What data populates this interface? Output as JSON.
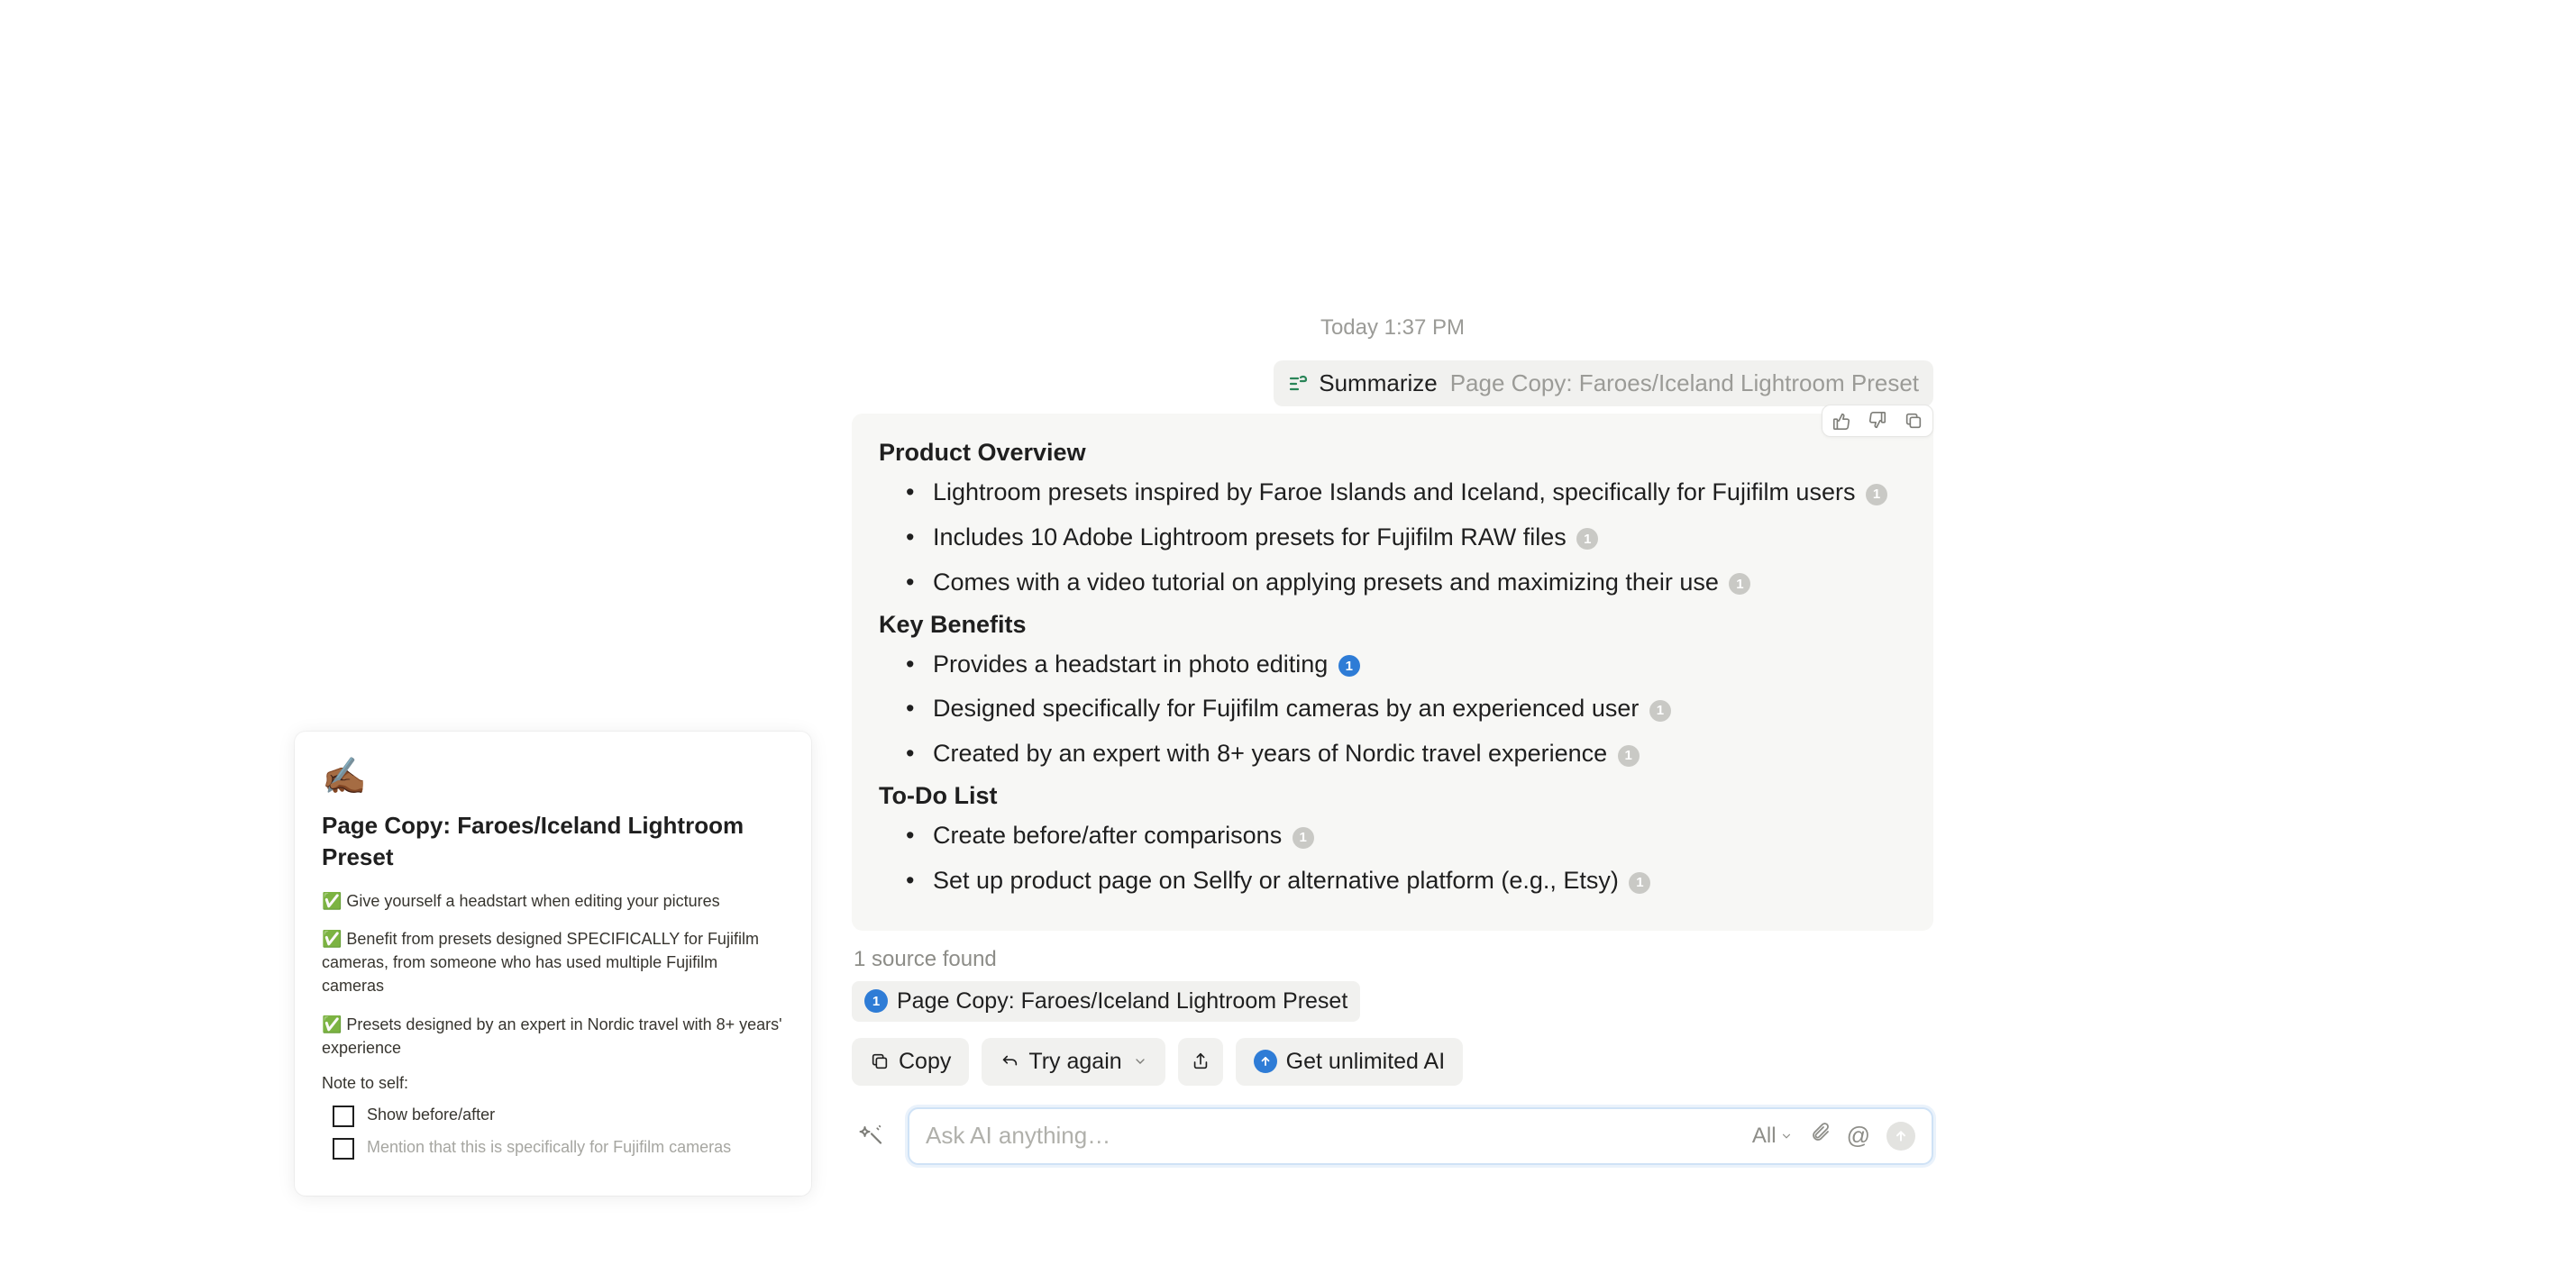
{
  "timestamp": "Today 1:37 PM",
  "prompt": {
    "action": "Summarize",
    "context": "Page Copy: Faroes/Iceland Lightroom Preset"
  },
  "left_card": {
    "emoji": "✍🏾",
    "title": "Page Copy: Faroes/Iceland Lightroom Preset",
    "benefits": [
      "✅ Give yourself a headstart when editing your pictures",
      "✅ Benefit from presets designed SPECIFICALLY for Fujifilm cameras, from someone who has used multiple Fujifilm cameras",
      "✅ Presets designed by an expert in Nordic travel with 8+ years' experience"
    ],
    "note_label": "Note to self:",
    "checkboxes": [
      {
        "label": "Show before/after",
        "dimmed": false
      },
      {
        "label": "Mention that this is specifically for Fujifilm cameras",
        "dimmed": true
      }
    ]
  },
  "response": {
    "sections": [
      {
        "heading": "Product Overview",
        "items": [
          {
            "text": "Lightroom presets inspired by Faroe Islands and Iceland, specifically for Fujifilm users",
            "cite": "1",
            "active": false
          },
          {
            "text": "Includes 10 Adobe Lightroom presets for Fujifilm RAW files",
            "cite": "1",
            "active": false
          },
          {
            "text": "Comes with a video tutorial on applying presets and maximizing their use",
            "cite": "1",
            "active": false
          }
        ]
      },
      {
        "heading": "Key Benefits",
        "items": [
          {
            "text": "Provides a headstart in photo editing",
            "cite": "1",
            "active": true
          },
          {
            "text": "Designed specifically for Fujifilm cameras by an experienced user",
            "cite": "1",
            "active": false
          },
          {
            "text": "Created by an expert with 8+ years of Nordic travel experience",
            "cite": "1",
            "active": false
          }
        ]
      },
      {
        "heading": "To-Do List",
        "items": [
          {
            "text": "Create before/after comparisons",
            "cite": "1",
            "active": false
          },
          {
            "text": "Set up product page on Sellfy or alternative platform (e.g., Etsy)",
            "cite": "1",
            "active": false
          }
        ]
      }
    ]
  },
  "sources": {
    "count_label": "1 source found",
    "items": [
      {
        "num": "1",
        "title": "Page Copy: Faroes/Iceland Lightroom Preset"
      }
    ]
  },
  "actions": {
    "copy": "Copy",
    "try_again": "Try again",
    "upgrade": "Get unlimited AI"
  },
  "input": {
    "placeholder": "Ask AI anything…",
    "scope": "All"
  }
}
